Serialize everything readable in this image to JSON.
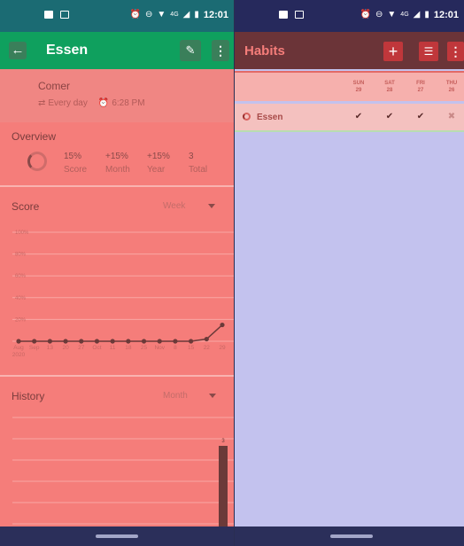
{
  "status_bar": {
    "time": "12:01",
    "network": "4G"
  },
  "detail": {
    "title": "Essen",
    "question": "Comer",
    "frequency": "Every day",
    "reminder": "6:28 PM",
    "overview": {
      "title": "Overview",
      "items": [
        {
          "value": "15%",
          "label": "Score"
        },
        {
          "value": "+15%",
          "label": "Month"
        },
        {
          "value": "+15%",
          "label": "Year"
        },
        {
          "value": "3",
          "label": "Total"
        }
      ]
    },
    "score": {
      "title": "Score",
      "period": "Week"
    },
    "history": {
      "title": "History",
      "period": "Month"
    }
  },
  "chart_data": [
    {
      "type": "line",
      "title": "Score",
      "ylim": [
        0,
        100
      ],
      "y_ticks": [
        "100%",
        "80%",
        "60%",
        "40%",
        "20%"
      ],
      "x": [
        "Aug\n2020",
        "Sep",
        "13",
        "20",
        "27",
        "Oct",
        "11",
        "18",
        "25",
        "Nov",
        "8",
        "15",
        "22",
        "29"
      ],
      "values": [
        0,
        0,
        0,
        0,
        0,
        0,
        0,
        0,
        0,
        0,
        0,
        0,
        2,
        15
      ],
      "grid": true
    },
    {
      "type": "bar",
      "title": "History",
      "values": [
        3
      ],
      "data_labels": [
        "3"
      ]
    }
  ],
  "habits_list": {
    "title": "Habits",
    "days": [
      {
        "name": "SUN",
        "num": "29"
      },
      {
        "name": "SAT",
        "num": "28"
      },
      {
        "name": "FRI",
        "num": "27"
      },
      {
        "name": "THU",
        "num": "26"
      }
    ],
    "habits": [
      {
        "name": "Essen",
        "checks": [
          "✔",
          "✔",
          "✔",
          "✖"
        ]
      }
    ]
  },
  "colors": {
    "habit": "#f57d7a",
    "toolbar_left": "#0fa05e",
    "toolbar_right": "#6b3438",
    "accent": "#c0373b"
  }
}
